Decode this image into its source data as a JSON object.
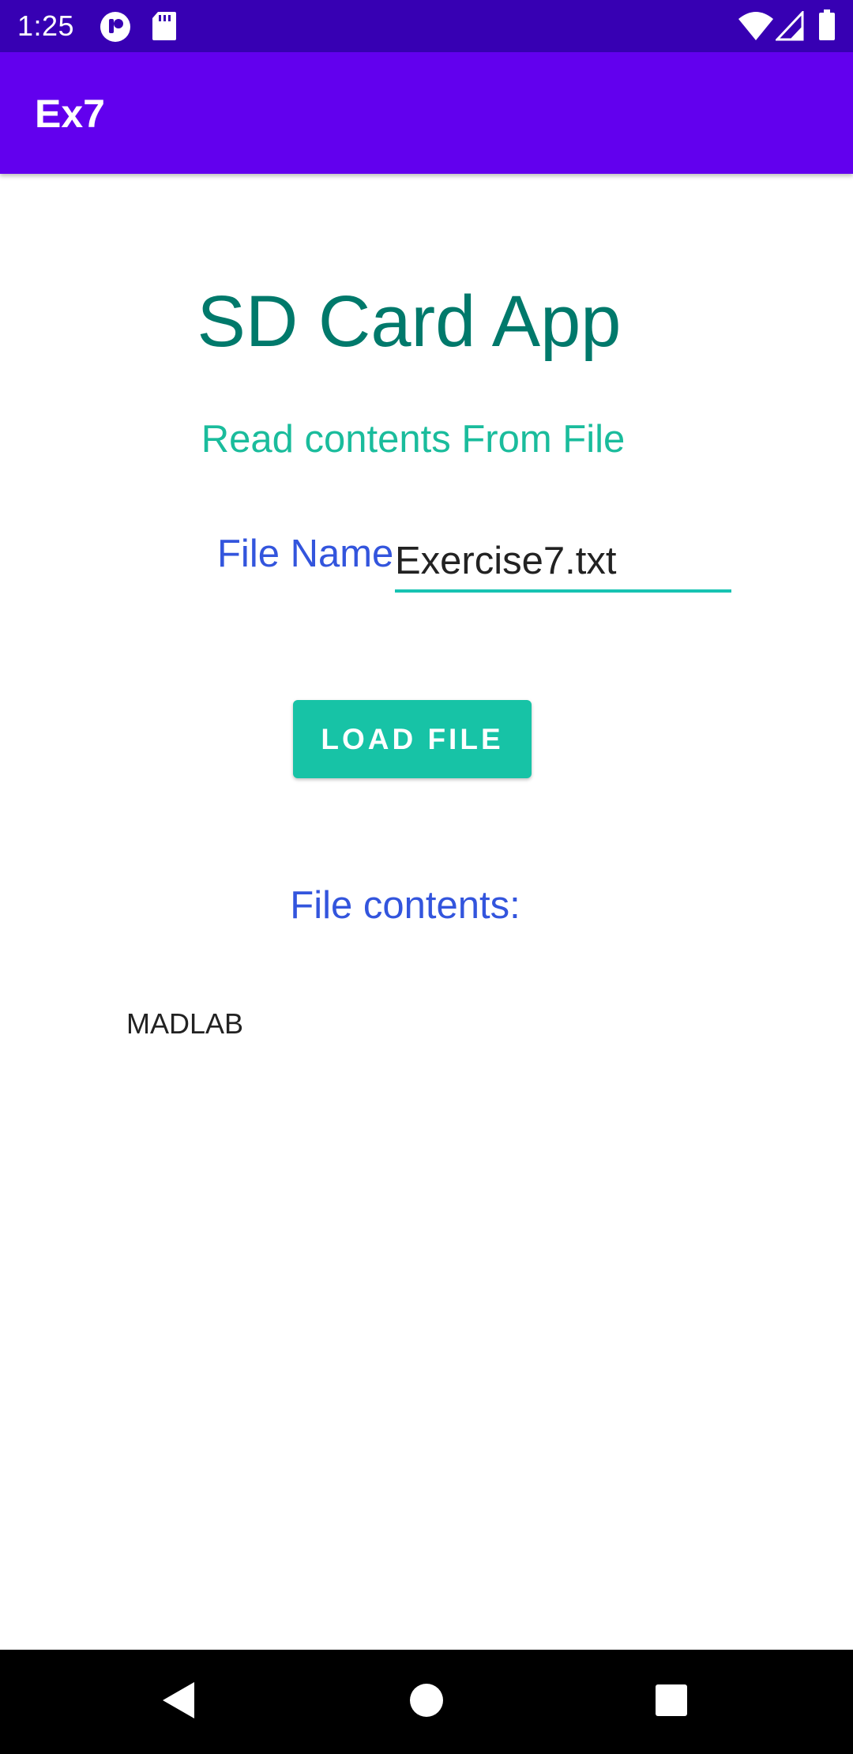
{
  "status_bar": {
    "time": "1:25",
    "icons": [
      "notification-icon",
      "sd-card-icon",
      "wifi-icon",
      "signal-icon",
      "battery-icon"
    ],
    "background_color": "#3700B3"
  },
  "app_bar": {
    "title": "Ex7",
    "background_color": "#6200EE"
  },
  "main": {
    "heading": "SD Card App",
    "subheading": "Read contents From File",
    "file_name_label": "File Name",
    "file_name_value": "Exercise7.txt",
    "load_button_label": "LOAD FILE",
    "contents_label": "File contents:",
    "contents_text": "MADLAB"
  },
  "nav_bar": {
    "buttons": [
      "back-icon",
      "home-icon",
      "recents-icon"
    ]
  },
  "colors": {
    "accent": "#17C3A6",
    "heading": "#00796B",
    "label_blue": "#3355DD"
  }
}
